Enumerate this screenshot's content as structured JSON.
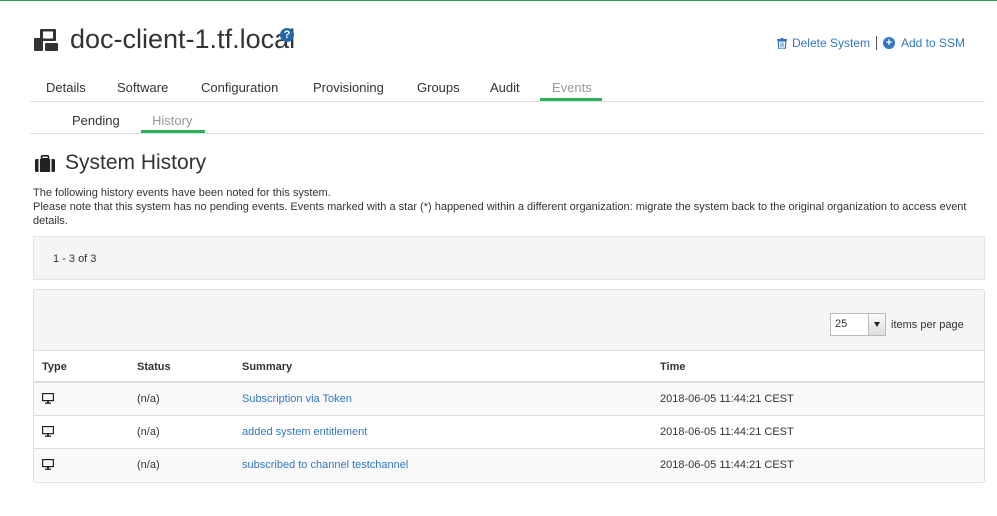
{
  "header": {
    "title": "doc-client-1.tf.local",
    "help_glyph": "?",
    "actions": {
      "delete": "Delete System",
      "add_ssm": "Add to SSM",
      "add_glyph": "+"
    }
  },
  "tabs": [
    {
      "label": "Details",
      "active": false
    },
    {
      "label": "Software",
      "active": false
    },
    {
      "label": "Configuration",
      "active": false
    },
    {
      "label": "Provisioning",
      "active": false
    },
    {
      "label": "Groups",
      "active": false
    },
    {
      "label": "Audit",
      "active": false
    },
    {
      "label": "Events",
      "active": true
    }
  ],
  "subtabs": [
    {
      "label": "Pending",
      "active": false
    },
    {
      "label": "History",
      "active": true
    }
  ],
  "section": {
    "title": "System History",
    "description_line1": "The following history events have been noted for this system.",
    "description_line2": "Please note that this system has no pending events. Events marked with a star (*) happened within a different organization: migrate the system back to the original organization to access event details."
  },
  "pagination": {
    "range_text": "1 - 3 of 3",
    "page_size": "25",
    "items_per_page_label": "items per page"
  },
  "table": {
    "columns": [
      "Type",
      "Status",
      "Summary",
      "Time"
    ],
    "rows": [
      {
        "type_icon": "monitor-icon",
        "status": "(n/a)",
        "summary": "Subscription via Token",
        "time": "2018-06-05 11:44:21 CEST"
      },
      {
        "type_icon": "monitor-icon",
        "status": "(n/a)",
        "summary": "added system entitlement",
        "time": "2018-06-05 11:44:21 CEST"
      },
      {
        "type_icon": "monitor-icon",
        "status": "(n/a)",
        "summary": "subscribed to channel testchannel",
        "time": "2018-06-05 11:44:21 CEST"
      }
    ]
  },
  "colors": {
    "accent_green": "#2ab25b",
    "link_blue": "#3277c0"
  }
}
